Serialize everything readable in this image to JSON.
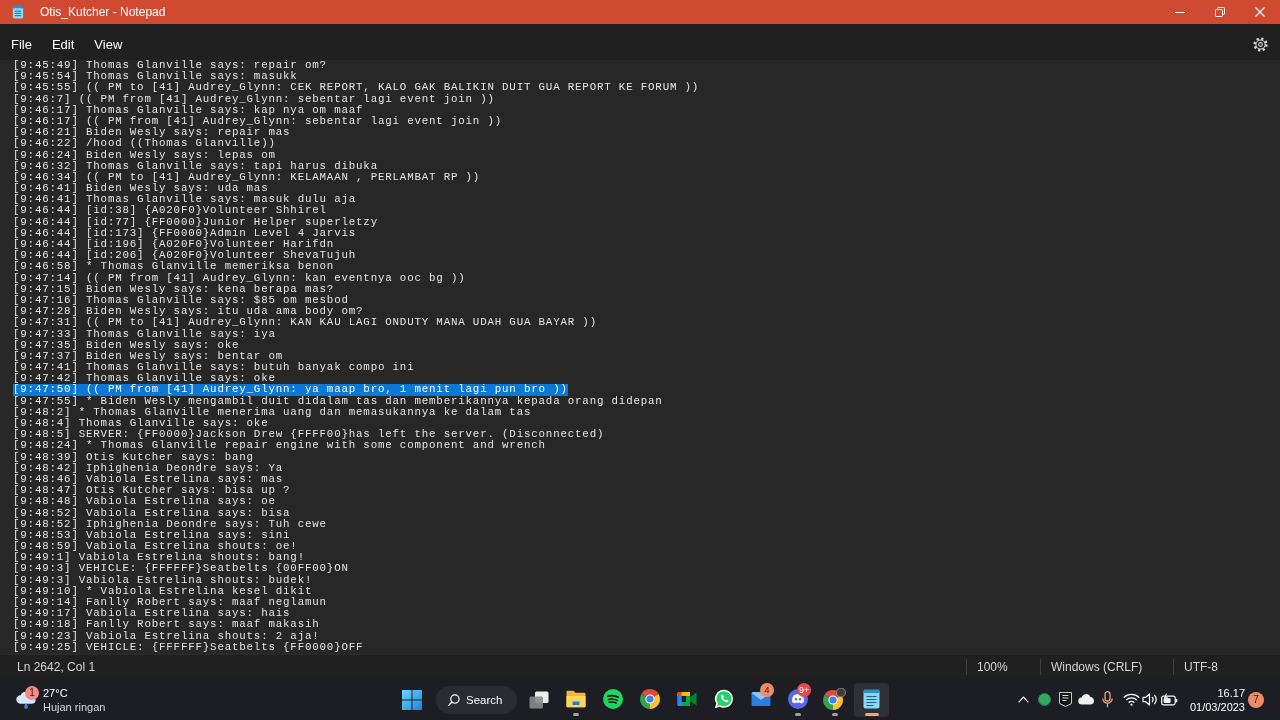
{
  "window": {
    "title": "Otis_Kutcher - Notepad"
  },
  "menu": [
    "File",
    "Edit",
    "View"
  ],
  "document": {
    "lines": [
      {
        "text": "[9:45:49] Thomas Glanville says: repair om?",
        "selected": false
      },
      {
        "text": "[9:45:54] Thomas Glanville says: masukk",
        "selected": false
      },
      {
        "text": "[9:45:55] (( PM to [41] Audrey_Glynn: CEK REPORT, KALO GAK BALIKIN DUIT GUA REPORT KE FORUM ))",
        "selected": false
      },
      {
        "text": "[9:46:7] (( PM from [41] Audrey_Glynn: sebentar lagi event join ))",
        "selected": false
      },
      {
        "text": "[9:46:17] Thomas Glanville says: kap nya om maaf",
        "selected": false
      },
      {
        "text": "[9:46:17] (( PM from [41] Audrey_Glynn: sebentar lagi event join ))",
        "selected": false
      },
      {
        "text": "[9:46:21] Biden Wesly says: repair mas",
        "selected": false
      },
      {
        "text": "[9:46:22] /hood ((Thomas Glanville))",
        "selected": false
      },
      {
        "text": "[9:46:24] Biden Wesly says: lepas om",
        "selected": false
      },
      {
        "text": "[9:46:32] Thomas Glanville says: tapi harus dibuka",
        "selected": false
      },
      {
        "text": "[9:46:34] (( PM to [41] Audrey_Glynn: KELAMAAN , PERLAMBAT RP ))",
        "selected": false
      },
      {
        "text": "[9:46:41] Biden Wesly says: uda mas",
        "selected": false
      },
      {
        "text": "[9:46:41] Thomas Glanville says: masuk dulu aja",
        "selected": false
      },
      {
        "text": "[9:46:44] [id:38] {A020F0}Volunteer Shhirel",
        "selected": false
      },
      {
        "text": "[9:46:44] [id:77] {FF0000}Junior Helper superletzy",
        "selected": false
      },
      {
        "text": "[9:46:44] [id:173] {FF0000}Admin Level 4 Jarvis",
        "selected": false
      },
      {
        "text": "[9:46:44] [id:196] {A020F0}Volunteer Harifdn",
        "selected": false
      },
      {
        "text": "[9:46:44] [id:206] {A020F0}Volunteer ShevaTujuh",
        "selected": false
      },
      {
        "text": "[9:46:58] * Thomas Glanville memeriksa benon",
        "selected": false
      },
      {
        "text": "[9:47:14] (( PM from [41] Audrey_Glynn: kan eventnya ooc bg ))",
        "selected": false
      },
      {
        "text": "[9:47:15] Biden Wesly says: kena berapa mas?",
        "selected": false
      },
      {
        "text": "[9:47:16] Thomas Glanville says: $85 om mesbod",
        "selected": false
      },
      {
        "text": "[9:47:28] Biden Wesly says: itu uda ama body om?",
        "selected": false
      },
      {
        "text": "[9:47:31] (( PM to [41] Audrey_Glynn: KAN KAU LAGI ONDUTY MANA UDAH GUA BAYAR ))",
        "selected": false
      },
      {
        "text": "[9:47:33] Thomas Glanville says: iya",
        "selected": false
      },
      {
        "text": "[9:47:35] Biden Wesly says: oke",
        "selected": false
      },
      {
        "text": "[9:47:37] Biden Wesly says: bentar om",
        "selected": false
      },
      {
        "text": "[9:47:41] Thomas Glanville says: butuh banyak compo ini",
        "selected": false
      },
      {
        "text": "[9:47:42] Thomas Glanville says: oke",
        "selected": false
      },
      {
        "text": "[9:47:50] (( PM from [41] Audrey_Glynn: ya maap bro, 1 menit lagi pun bro ))",
        "selected": true
      },
      {
        "text": "[9:47:55] * Biden Wesly mengambil duit didalam tas dan memberikannya kepada orang didepan",
        "selected": false
      },
      {
        "text": "[9:48:2] * Thomas Glanville menerima uang dan memasukannya ke dalam tas",
        "selected": false
      },
      {
        "text": "[9:48:4] Thomas Glanville says: oke",
        "selected": false
      },
      {
        "text": "[9:48:5] SERVER: {FF0000}Jackson Drew {FFFF00}has left the server. (Disconnected)",
        "selected": false
      },
      {
        "text": "[9:48:24] * Thomas Glanville repair engine with some component and wrench",
        "selected": false
      },
      {
        "text": "[9:48:39] Otis Kutcher says: bang",
        "selected": false
      },
      {
        "text": "[9:48:42] Iphighenia Deondre says: Ya",
        "selected": false
      },
      {
        "text": "[9:48:46] Vabiola Estrelina says: mas",
        "selected": false
      },
      {
        "text": "[9:48:47] Otis Kutcher says: bisa up ?",
        "selected": false
      },
      {
        "text": "[9:48:48] Vabiola Estrelina says: oe",
        "selected": false
      },
      {
        "text": "[9:48:52] Vabiola Estrelina says: bisa",
        "selected": false
      },
      {
        "text": "[9:48:52] Iphighenia Deondre says: Tuh cewe",
        "selected": false
      },
      {
        "text": "[9:48:53] Vabiola Estrelina says: sini",
        "selected": false
      },
      {
        "text": "[9:48:59] Vabiola Estrelina shouts: oe!",
        "selected": false
      },
      {
        "text": "[9:49:1] Vabiola Estrelina shouts: bang!",
        "selected": false
      },
      {
        "text": "[9:49:3] VEHICLE: {FFFFFF}Seatbelts {00FF00}ON",
        "selected": false
      },
      {
        "text": "[9:49:3] Vabiola Estrelina shouts: budek!",
        "selected": false
      },
      {
        "text": "[9:49:10] * Vabiola Estrelina kesel dikit",
        "selected": false
      },
      {
        "text": "[9:49:14] Fanlly Robert says: maaf neglamun",
        "selected": false
      },
      {
        "text": "[9:49:17] Vabiola Estrelina says: hais",
        "selected": false
      },
      {
        "text": "[9:49:18] Fanlly Robert says: maaf makasih",
        "selected": false
      },
      {
        "text": "[9:49:23] Vabiola Estrelina shouts: 2 aja!",
        "selected": false
      },
      {
        "text": "[9:49:25] VEHICLE: {FFFFFF}Seatbelts {FF0000}OFF",
        "selected": false
      }
    ]
  },
  "status_bar": {
    "position": "Ln 2642, Col 1",
    "zoom": "100%",
    "line_ending": "Windows (CRLF)",
    "encoding": "UTF-8"
  },
  "taskbar": {
    "weather": {
      "badge": "1",
      "temperature": "27°C",
      "condition": "Hujan ringan"
    },
    "search": {
      "label": "Search"
    },
    "apps": [
      {
        "kind": "folder",
        "running": true,
        "selected": false
      },
      {
        "kind": "music",
        "running": false,
        "selected": false
      },
      {
        "kind": "browser",
        "running": false,
        "selected": false
      },
      {
        "kind": "video",
        "running": false,
        "selected": false
      },
      {
        "kind": "chat",
        "running": false,
        "selected": false
      },
      {
        "kind": "mail",
        "running": false,
        "selected": false,
        "badge": "4"
      },
      {
        "kind": "voice",
        "running": true,
        "selected": false,
        "badge": "9+"
      },
      {
        "kind": "browser-profile",
        "running": true,
        "selected": false
      },
      {
        "kind": "notepad",
        "running": true,
        "selected": true
      }
    ],
    "clock": {
      "time": "16.17",
      "date": "01/03/2023"
    },
    "notifications": {
      "count": "7"
    }
  }
}
